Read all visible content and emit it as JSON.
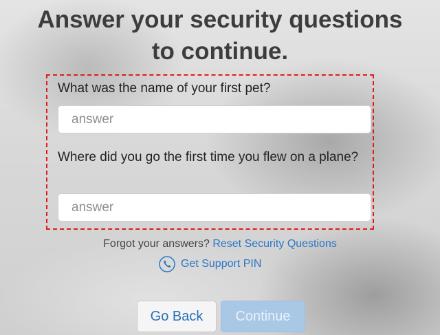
{
  "title": {
    "line1": "Answer your security questions",
    "line2": "to continue."
  },
  "questions": [
    {
      "label": "What was the name of your first pet?",
      "placeholder": "answer",
      "value": ""
    },
    {
      "label": "Where did you go the first time you flew on a plane?",
      "placeholder": "answer",
      "value": ""
    }
  ],
  "forgot": {
    "text": "Forgot your answers?",
    "link": "Reset Security Questions"
  },
  "support": {
    "icon": "phone-icon",
    "label": "Get Support PIN"
  },
  "buttons": {
    "back": "Go Back",
    "continue": "Continue"
  },
  "colors": {
    "link": "#2a76c6",
    "highlight_border": "#e01b1b",
    "continue_disabled": "#a9c8e6"
  }
}
